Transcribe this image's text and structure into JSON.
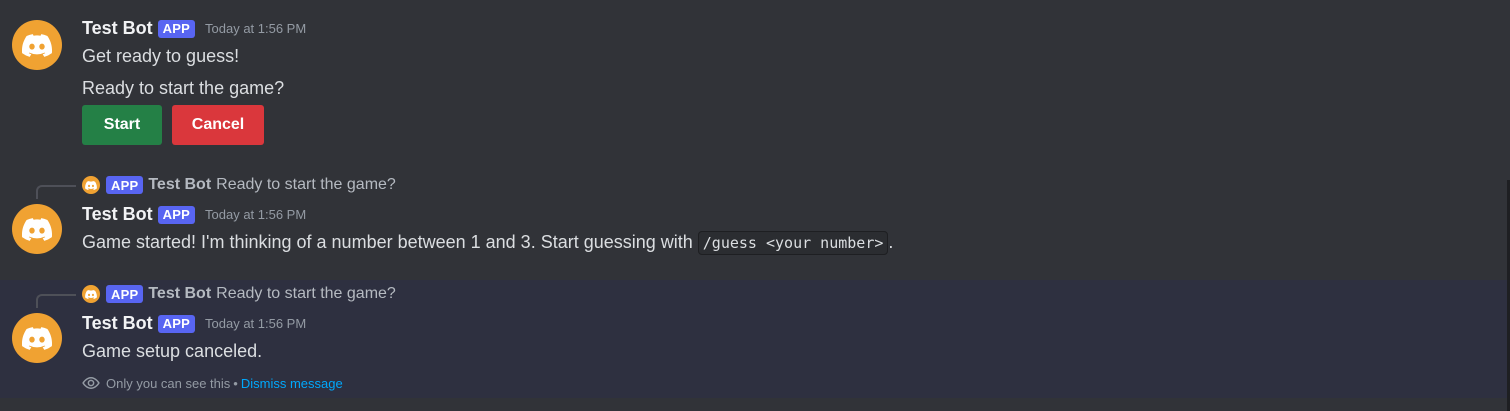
{
  "bot": {
    "name": "Test Bot",
    "tag": "APP",
    "avatar_icon": "discord-icon",
    "avatar_color": "#f0a232"
  },
  "messages": [
    {
      "timestamp": "Today at 1:56 PM",
      "lines": [
        "Get ready to guess!",
        "Ready to start the game?"
      ],
      "buttons": [
        {
          "label": "Start",
          "style": "success",
          "color": "#248046"
        },
        {
          "label": "Cancel",
          "style": "danger",
          "color": "#da373c"
        }
      ]
    },
    {
      "reply": {
        "name": "Test Bot",
        "tag": "APP",
        "text": "Ready to start the game?"
      },
      "timestamp": "Today at 1:56 PM",
      "text_before": "Game started! I'm thinking of a number between 1 and 3. Start guessing with ",
      "code": "/guess <your number>",
      "text_after": "."
    },
    {
      "reply": {
        "name": "Test Bot",
        "tag": "APP",
        "text": "Ready to start the game?"
      },
      "timestamp": "Today at 1:56 PM",
      "text": "Game setup canceled.",
      "ephemeral": {
        "icon": "eye-icon",
        "notice": "Only you can see this",
        "separator": "•",
        "dismiss": "Dismiss message"
      }
    }
  ],
  "colors": {
    "background": "#313338",
    "ephemeral_background": "#2e3040",
    "app_tag": "#5865f2",
    "link": "#00a8fc"
  }
}
